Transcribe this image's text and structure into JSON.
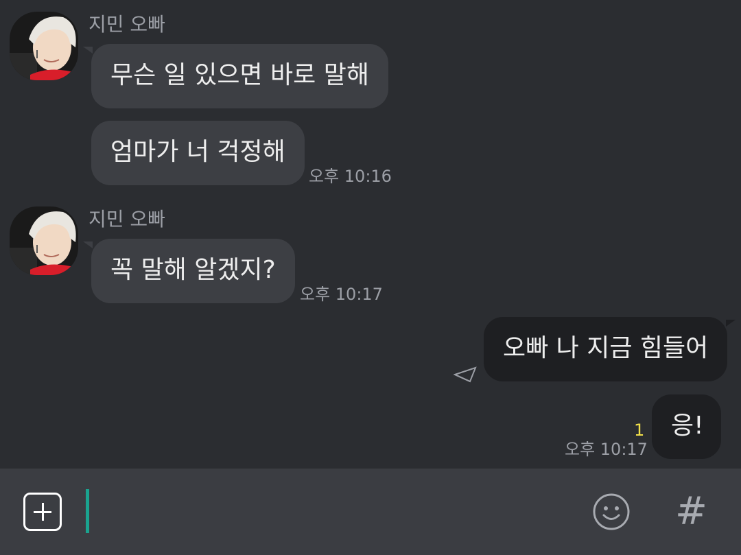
{
  "messages": [
    {
      "sender": "지민 오빠",
      "bubbles": [
        "무슨 일 있으면 바로 말해",
        "엄마가 너 걱정해"
      ],
      "time": "오후 10:16"
    },
    {
      "sender": "지민 오빠",
      "bubbles": [
        "꼭 말해 알겠지?"
      ],
      "time": "오후 10:17"
    }
  ],
  "my_messages": {
    "bubbles": [
      "오빠 나 지금 힘들어",
      "응!"
    ],
    "unread_count": "1",
    "time": "오후 10:17"
  },
  "composer": {
    "input_value": "",
    "plus_icon": "plus-square-icon",
    "emoji_icon": "smiley-icon",
    "hash_label": "#"
  },
  "colors": {
    "background": "#2b2d31",
    "incoming_bubble": "#3d3f44",
    "outgoing_bubble": "#1e1f22",
    "unread": "#f3e14a",
    "caret": "#1aa38f"
  }
}
